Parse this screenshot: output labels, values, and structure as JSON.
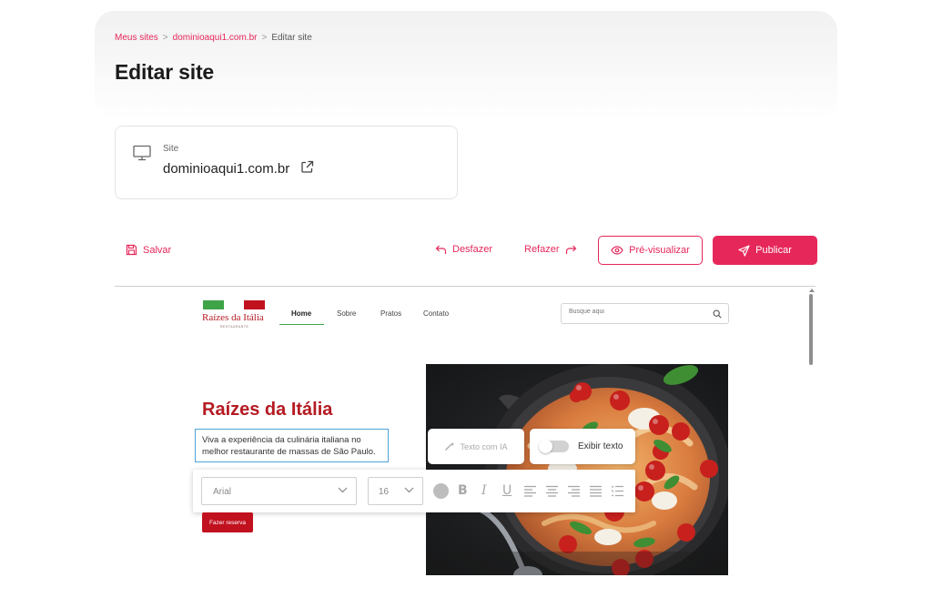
{
  "breadcrumb": {
    "items": [
      "Meus sites",
      "dominioaqui1.com.br",
      "Editar site"
    ],
    "separator": ">"
  },
  "page": {
    "title": "Editar site"
  },
  "site_card": {
    "label": "Site",
    "domain": "dominioaqui1.com.br",
    "icon": "monitor-icon",
    "link_icon": "external-link-icon"
  },
  "toolbar": {
    "save_label": "Salvar",
    "undo_label": "Desfazer",
    "redo_label": "Refazer",
    "preview_label": "Pré-visualizar",
    "publish_label": "Publicar"
  },
  "colors": {
    "accent": "#e6275a",
    "site_brand_red": "#b51a22",
    "site_brand_green": "#3ea447",
    "selection_blue": "#4fa3da"
  },
  "site_preview": {
    "logo": {
      "name": "Raízes da Itália",
      "tagline": "RESTAURANTE"
    },
    "nav": [
      "Home",
      "Sobre",
      "Pratos",
      "Contato"
    ],
    "active_nav": "Home",
    "search_placeholder": "Busque aqui",
    "hero": {
      "title": "Raízes da Itália",
      "text": "Viva a experiência da culinária italiana no melhor restaurante de massas de São Paulo.",
      "button_label": "Fazer reserva"
    }
  },
  "editor": {
    "ai_text_label": "Texto com IA",
    "show_text_label": "Exibir texto",
    "show_text_on": false,
    "font_family": "Arial",
    "font_size": "16"
  }
}
